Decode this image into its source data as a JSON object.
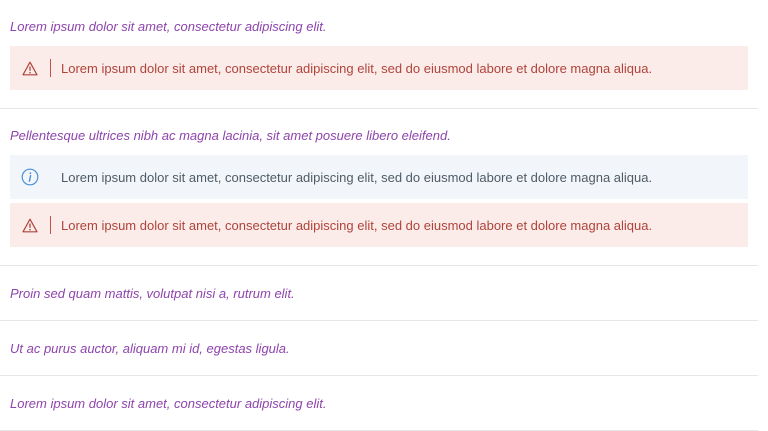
{
  "sections": [
    {
      "title": "Lorem ipsum dolor sit amet, consectetur adipiscing elit.",
      "alerts": [
        {
          "type": "danger",
          "icon": "warning-icon",
          "text": "Lorem ipsum dolor sit amet, consectetur adipiscing elit, sed do eiusmod labore et dolore magna aliqua."
        }
      ]
    },
    {
      "title": "Pellentesque ultrices nibh ac magna lacinia, sit amet posuere libero eleifend.",
      "alerts": [
        {
          "type": "info",
          "icon": "info-icon",
          "text": "Lorem ipsum dolor sit amet, consectetur adipiscing elit, sed do eiusmod labore et dolore magna aliqua."
        },
        {
          "type": "danger",
          "icon": "warning-icon",
          "text": "Lorem ipsum dolor sit amet, consectetur adipiscing elit, sed do eiusmod labore et dolore magna aliqua."
        }
      ]
    },
    {
      "title": "Proin sed quam mattis, volutpat nisi a, rutrum elit.",
      "alerts": []
    },
    {
      "title": "Ut ac purus auctor, aliquam mi id, egestas ligula.",
      "alerts": []
    },
    {
      "title": "Lorem ipsum dolor sit amet, consectetur adipiscing elit.",
      "alerts": []
    }
  ],
  "colors": {
    "title": "#8e44ad",
    "danger_bg": "#fbecea",
    "danger_text": "#b0433a",
    "info_bg": "#f2f6fa",
    "info_text": "#4f5b66",
    "info_icon": "#4a90d9",
    "divider": "#e6e6e6"
  }
}
